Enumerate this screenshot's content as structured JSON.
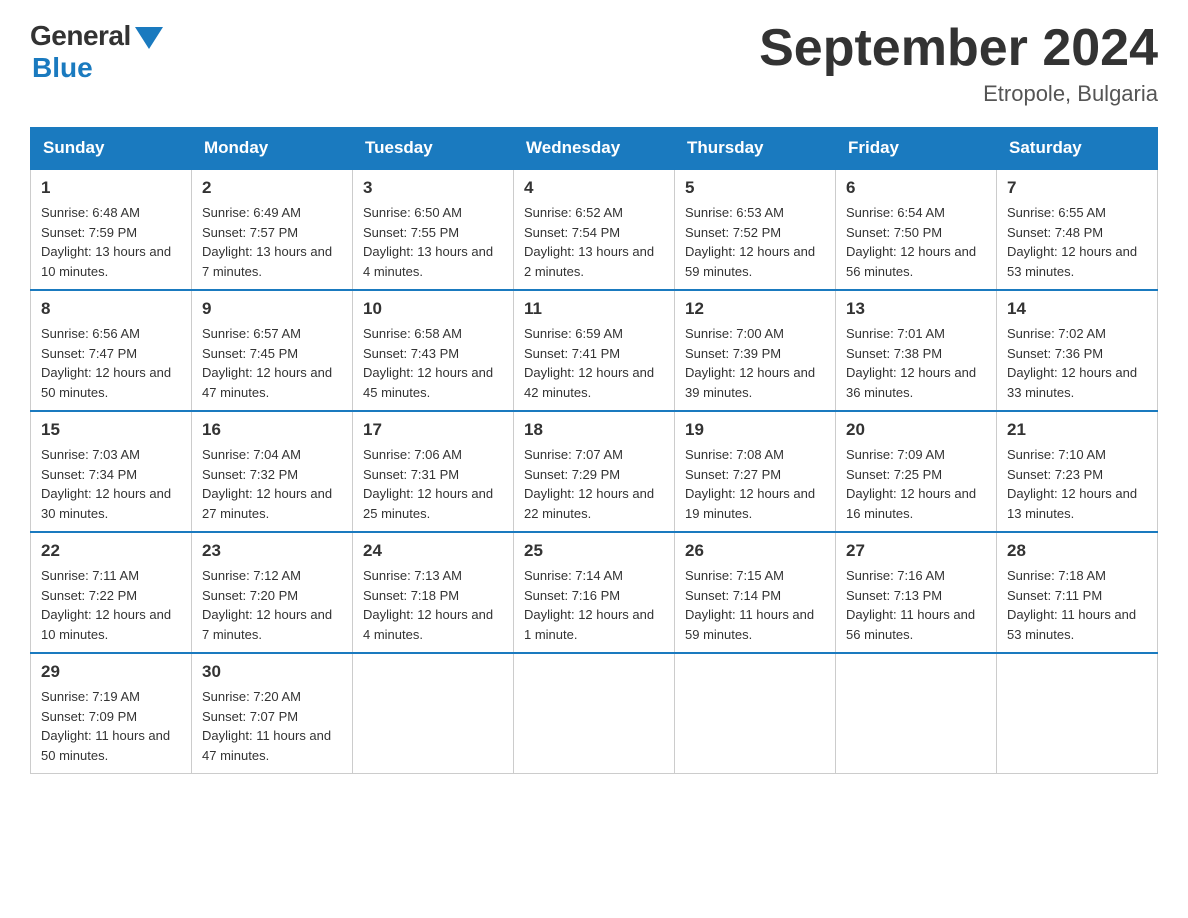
{
  "logo": {
    "general": "General",
    "blue": "Blue"
  },
  "title": "September 2024",
  "subtitle": "Etropole, Bulgaria",
  "days_of_week": [
    "Sunday",
    "Monday",
    "Tuesday",
    "Wednesday",
    "Thursday",
    "Friday",
    "Saturday"
  ],
  "weeks": [
    [
      {
        "day": "1",
        "sunrise": "6:48 AM",
        "sunset": "7:59 PM",
        "daylight": "13 hours and 10 minutes."
      },
      {
        "day": "2",
        "sunrise": "6:49 AM",
        "sunset": "7:57 PM",
        "daylight": "13 hours and 7 minutes."
      },
      {
        "day": "3",
        "sunrise": "6:50 AM",
        "sunset": "7:55 PM",
        "daylight": "13 hours and 4 minutes."
      },
      {
        "day": "4",
        "sunrise": "6:52 AM",
        "sunset": "7:54 PM",
        "daylight": "13 hours and 2 minutes."
      },
      {
        "day": "5",
        "sunrise": "6:53 AM",
        "sunset": "7:52 PM",
        "daylight": "12 hours and 59 minutes."
      },
      {
        "day": "6",
        "sunrise": "6:54 AM",
        "sunset": "7:50 PM",
        "daylight": "12 hours and 56 minutes."
      },
      {
        "day": "7",
        "sunrise": "6:55 AM",
        "sunset": "7:48 PM",
        "daylight": "12 hours and 53 minutes."
      }
    ],
    [
      {
        "day": "8",
        "sunrise": "6:56 AM",
        "sunset": "7:47 PM",
        "daylight": "12 hours and 50 minutes."
      },
      {
        "day": "9",
        "sunrise": "6:57 AM",
        "sunset": "7:45 PM",
        "daylight": "12 hours and 47 minutes."
      },
      {
        "day": "10",
        "sunrise": "6:58 AM",
        "sunset": "7:43 PM",
        "daylight": "12 hours and 45 minutes."
      },
      {
        "day": "11",
        "sunrise": "6:59 AM",
        "sunset": "7:41 PM",
        "daylight": "12 hours and 42 minutes."
      },
      {
        "day": "12",
        "sunrise": "7:00 AM",
        "sunset": "7:39 PM",
        "daylight": "12 hours and 39 minutes."
      },
      {
        "day": "13",
        "sunrise": "7:01 AM",
        "sunset": "7:38 PM",
        "daylight": "12 hours and 36 minutes."
      },
      {
        "day": "14",
        "sunrise": "7:02 AM",
        "sunset": "7:36 PM",
        "daylight": "12 hours and 33 minutes."
      }
    ],
    [
      {
        "day": "15",
        "sunrise": "7:03 AM",
        "sunset": "7:34 PM",
        "daylight": "12 hours and 30 minutes."
      },
      {
        "day": "16",
        "sunrise": "7:04 AM",
        "sunset": "7:32 PM",
        "daylight": "12 hours and 27 minutes."
      },
      {
        "day": "17",
        "sunrise": "7:06 AM",
        "sunset": "7:31 PM",
        "daylight": "12 hours and 25 minutes."
      },
      {
        "day": "18",
        "sunrise": "7:07 AM",
        "sunset": "7:29 PM",
        "daylight": "12 hours and 22 minutes."
      },
      {
        "day": "19",
        "sunrise": "7:08 AM",
        "sunset": "7:27 PM",
        "daylight": "12 hours and 19 minutes."
      },
      {
        "day": "20",
        "sunrise": "7:09 AM",
        "sunset": "7:25 PM",
        "daylight": "12 hours and 16 minutes."
      },
      {
        "day": "21",
        "sunrise": "7:10 AM",
        "sunset": "7:23 PM",
        "daylight": "12 hours and 13 minutes."
      }
    ],
    [
      {
        "day": "22",
        "sunrise": "7:11 AM",
        "sunset": "7:22 PM",
        "daylight": "12 hours and 10 minutes."
      },
      {
        "day": "23",
        "sunrise": "7:12 AM",
        "sunset": "7:20 PM",
        "daylight": "12 hours and 7 minutes."
      },
      {
        "day": "24",
        "sunrise": "7:13 AM",
        "sunset": "7:18 PM",
        "daylight": "12 hours and 4 minutes."
      },
      {
        "day": "25",
        "sunrise": "7:14 AM",
        "sunset": "7:16 PM",
        "daylight": "12 hours and 1 minute."
      },
      {
        "day": "26",
        "sunrise": "7:15 AM",
        "sunset": "7:14 PM",
        "daylight": "11 hours and 59 minutes."
      },
      {
        "day": "27",
        "sunrise": "7:16 AM",
        "sunset": "7:13 PM",
        "daylight": "11 hours and 56 minutes."
      },
      {
        "day": "28",
        "sunrise": "7:18 AM",
        "sunset": "7:11 PM",
        "daylight": "11 hours and 53 minutes."
      }
    ],
    [
      {
        "day": "29",
        "sunrise": "7:19 AM",
        "sunset": "7:09 PM",
        "daylight": "11 hours and 50 minutes."
      },
      {
        "day": "30",
        "sunrise": "7:20 AM",
        "sunset": "7:07 PM",
        "daylight": "11 hours and 47 minutes."
      },
      null,
      null,
      null,
      null,
      null
    ]
  ]
}
